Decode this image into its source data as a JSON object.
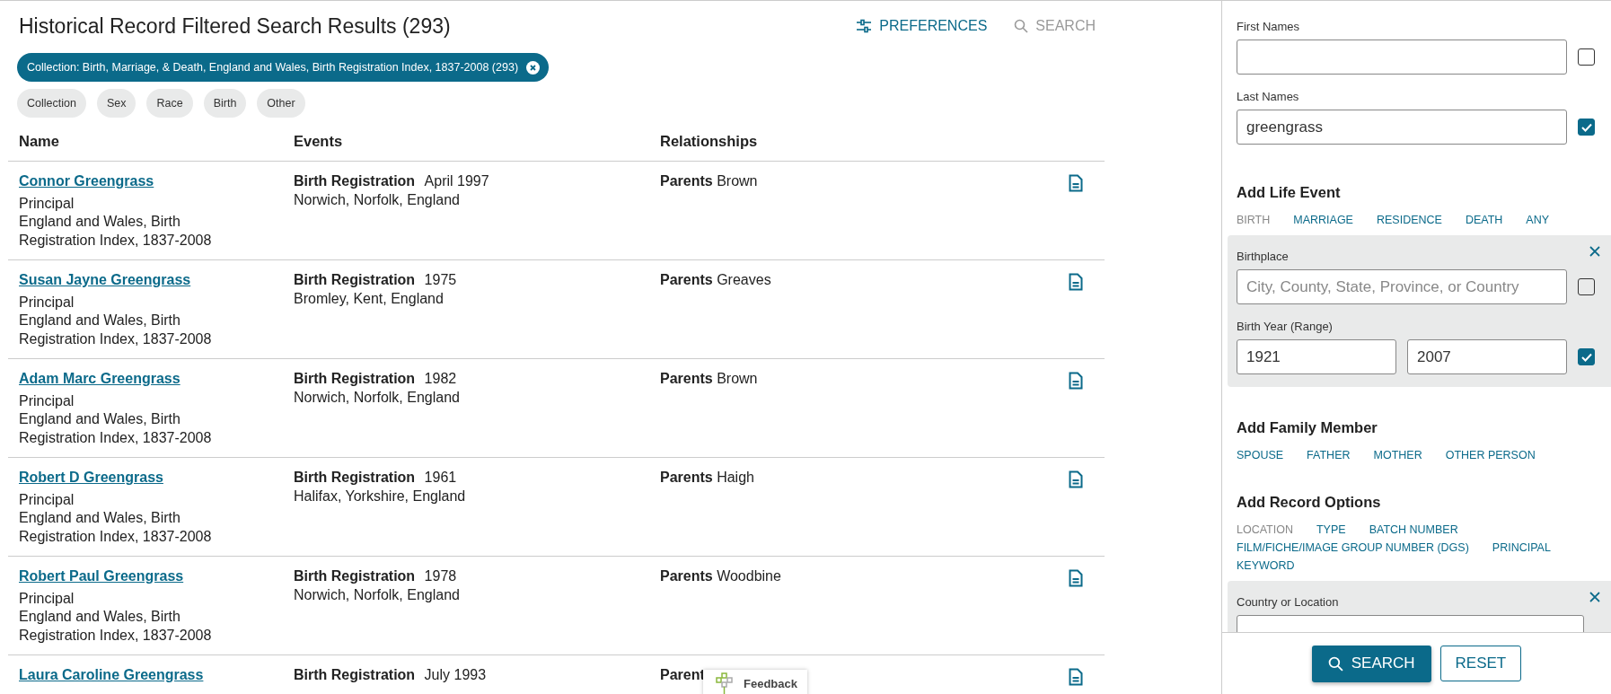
{
  "header": {
    "title": "Historical Record Filtered Search Results (293)",
    "preferences": "PREFERENCES",
    "search": "SEARCH"
  },
  "active_filter": {
    "label": "Collection: Birth, Marriage, & Death, England and Wales, Birth Registration Index, 1837-2008 (293)"
  },
  "filter_chips": [
    "Collection",
    "Sex",
    "Race",
    "Birth",
    "Other"
  ],
  "table": {
    "columns": [
      "Name",
      "Events",
      "Relationships"
    ],
    "rows": [
      {
        "name": "Connor Greengrass",
        "role": "Principal",
        "collection": "England and Wales, Birth Registration Index, 1837-2008",
        "event_type": "Birth Registration",
        "event_date": "April 1997",
        "event_place": "Norwich, Norfolk, England",
        "relation_label": "Parents",
        "relation_value": "Brown"
      },
      {
        "name": "Susan Jayne Greengrass",
        "role": "Principal",
        "collection": "England and Wales, Birth Registration Index, 1837-2008",
        "event_type": "Birth Registration",
        "event_date": "1975",
        "event_place": "Bromley, Kent, England",
        "relation_label": "Parents",
        "relation_value": "Greaves"
      },
      {
        "name": "Adam Marc Greengrass",
        "role": "Principal",
        "collection": "England and Wales, Birth Registration Index, 1837-2008",
        "event_type": "Birth Registration",
        "event_date": "1982",
        "event_place": "Norwich, Norfolk, England",
        "relation_label": "Parents",
        "relation_value": "Brown"
      },
      {
        "name": "Robert D Greengrass",
        "role": "Principal",
        "collection": "England and Wales, Birth Registration Index, 1837-2008",
        "event_type": "Birth Registration",
        "event_date": "1961",
        "event_place": "Halifax, Yorkshire, England",
        "relation_label": "Parents",
        "relation_value": "Haigh"
      },
      {
        "name": "Robert Paul Greengrass",
        "role": "Principal",
        "collection": "England and Wales, Birth Registration Index, 1837-2008",
        "event_type": "Birth Registration",
        "event_date": "1978",
        "event_place": "Norwich, Norfolk, England",
        "relation_label": "Parents",
        "relation_value": "Woodbine"
      },
      {
        "name": "Laura Caroline Greengrass",
        "event_type": "Birth Registration",
        "event_date": "July 1993",
        "relation_label": "Parent"
      }
    ]
  },
  "feedback": {
    "label": "Feedback"
  },
  "search_form": {
    "name_fields": [
      {
        "label": "First Names",
        "checked": false
      },
      {
        "label": "Last Names",
        "value": "greengrass",
        "checked": true
      }
    ],
    "life_event": {
      "heading": "Add Life Event",
      "options": [
        {
          "label": "BIRTH",
          "disabled": true
        },
        {
          "label": "MARRIAGE",
          "disabled": false
        },
        {
          "label": "RESIDENCE",
          "disabled": false
        },
        {
          "label": "DEATH",
          "disabled": false
        },
        {
          "label": "ANY",
          "disabled": false
        }
      ],
      "panel_fields": [
        {
          "kind": "text",
          "label": "Birthplace",
          "placeholder": "City, County, State, Province, or Country",
          "checked": false
        },
        {
          "kind": "range",
          "label": "Birth Year (Range)",
          "from": "1921",
          "to": "2007",
          "checked": true
        }
      ]
    },
    "family_member": {
      "heading": "Add Family Member",
      "options": [
        {
          "label": "SPOUSE",
          "disabled": false
        },
        {
          "label": "FATHER",
          "disabled": false
        },
        {
          "label": "MOTHER",
          "disabled": false
        },
        {
          "label": "OTHER PERSON",
          "disabled": false
        }
      ]
    },
    "record_options": {
      "heading": "Add Record Options",
      "options": [
        {
          "label": "LOCATION",
          "disabled": true
        },
        {
          "label": "TYPE",
          "disabled": false
        },
        {
          "label": "BATCH NUMBER",
          "disabled": false
        },
        {
          "label": "FILM/FICHE/IMAGE GROUP NUMBER (DGS)",
          "disabled": false
        },
        {
          "label": "PRINCIPAL",
          "disabled": false
        },
        {
          "label": "KEYWORD",
          "disabled": false
        }
      ],
      "panel_label": "Country or Location"
    },
    "buttons": {
      "search": "SEARCH",
      "reset": "RESET"
    }
  }
}
